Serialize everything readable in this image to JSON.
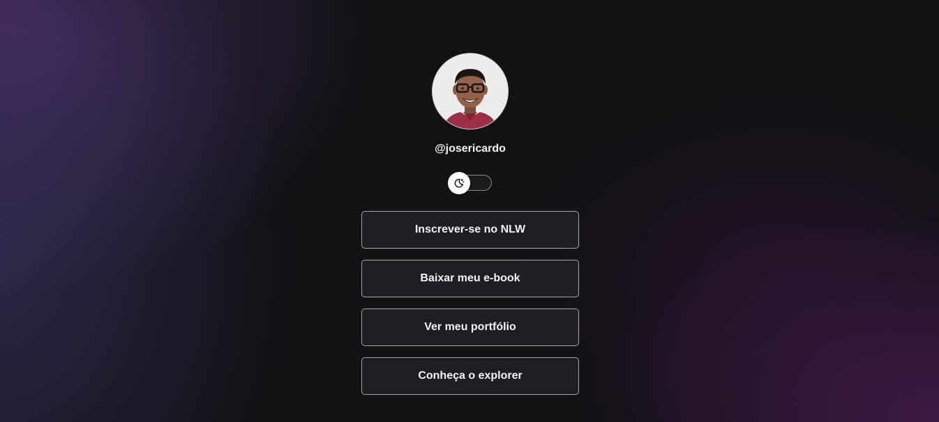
{
  "profile": {
    "handle": "@josericardo"
  },
  "theme_switch": {
    "icon": "moon-icon",
    "state": "dark"
  },
  "links": [
    {
      "label": "Inscrever-se no NLW"
    },
    {
      "label": "Baixar meu e-book"
    },
    {
      "label": "Ver meu portfólio"
    },
    {
      "label": "Conheça o explorer"
    }
  ],
  "colors": {
    "background": "#121114",
    "button_border": "#a6a6ab",
    "text": "#f4f4f5"
  }
}
